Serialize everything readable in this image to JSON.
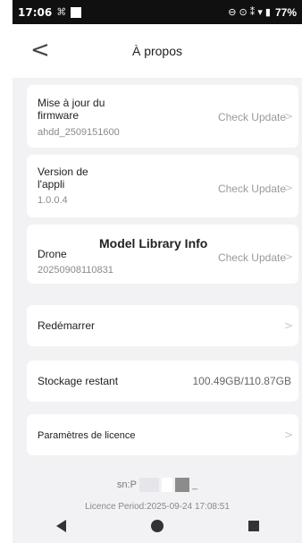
{
  "status": {
    "time": "17:06",
    "extra": "⌘",
    "icons": "⊖ ⊙ ⁑ ▾ ▮",
    "battery": "77%"
  },
  "header": {
    "back": "<",
    "title": "À propos"
  },
  "firmware": {
    "label_line1": "Mise à jour du",
    "label_line2": "firmware",
    "value": "ahdd_2509151600",
    "action": "Check Update",
    "chevron": ">"
  },
  "app_version": {
    "label_line1": "Version de",
    "label_line2": "l'appli",
    "value": "1.0.0.4",
    "action": "Check Update",
    "chevron": ">"
  },
  "drone": {
    "label": "Drone",
    "overlay_text": "Model Library Info",
    "value": "20250908110831",
    "action": "Check Update",
    "chevron": ">"
  },
  "restart": {
    "label": "Redémarrer",
    "chevron": ">"
  },
  "storage": {
    "label": "Stockage restant",
    "value": "100.49GB/110.87GB"
  },
  "license": {
    "label": "Paramètres de licence",
    "chevron": ">"
  },
  "footer": {
    "sn_prefix": "sn:P",
    "sn_suffix": "_",
    "license_period": "Licence Period:2025-09-24 17:08:51"
  },
  "colors": {
    "background": "#f2f2f4",
    "card": "#ffffff",
    "muted": "#9a9a9a"
  }
}
